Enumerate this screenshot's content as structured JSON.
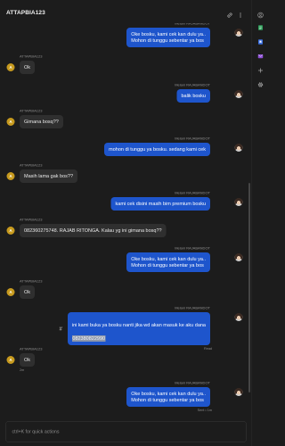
{
  "header": {
    "title": "ATTAPBIA123",
    "icons": [
      "link-icon",
      "more-vertical-icon"
    ]
  },
  "contact": {
    "avatar_letter": "A"
  },
  "messages": [
    {
      "sender": "Melani RAJABANDOT",
      "text": "Oke bosku, kami cek kan dulu ya..\nMohon di tunggu sebentar ya bos"
    },
    {
      "sender": "ATTAPBIA123",
      "text": "Ok"
    },
    {
      "sender": "Melani RAJABANDOT",
      "text": "balik bosku"
    },
    {
      "sender": "ATTAPBIA123",
      "text": "Gimana bosq??"
    },
    {
      "sender": "Melani RAJABANDOT",
      "text": "mohon di tunggu ya bosku. sedang kami cek"
    },
    {
      "sender": "ATTAPBIA123",
      "text": "Masih lama gak bos??"
    },
    {
      "sender": "Melani RAJABANDOT",
      "text": "kami cek disini masih bim premium bosku"
    },
    {
      "sender": "ATTAPBIA123",
      "text": "082360275748. RAJAB RITONGA. Kalau yg ini gimana bosq??"
    },
    {
      "sender": "Melani RAJABANDOT",
      "text": "Oke bosku, kami cek kan dulu ya..\nMohon di tunggu sebentar ya bos"
    },
    {
      "sender": "ATTAPBIA123",
      "text": "Ok"
    },
    {
      "sender": "Melani RAJABANDOT",
      "marker": "#",
      "text": "ini kami buka ya bosku nanti jika wd akan masuk ke aku dana",
      "highlight": "082380822990",
      "meta": "Read"
    },
    {
      "sender": "ATTAPBIA123",
      "text": "Ok",
      "meta": "2m"
    },
    {
      "sender": "Melani RAJABANDOT",
      "text": "Oke bosku, kami cek kan dulu ya..\nMohon di tunggu sebentar ya bos",
      "meta": "Sent • 1m"
    }
  ],
  "composer": {
    "placeholder": "ctrl+K for quick actions"
  },
  "sidebar": {
    "icons": [
      "user-circle-icon",
      "green-app-icon",
      "blue-document-icon",
      "purple-mail-icon",
      "plus-icon",
      "settings-gear-icon"
    ]
  },
  "colors": {
    "background": "#1c1c1c",
    "outgoing_bubble": "#1e55cc",
    "incoming_bubble": "#2f2f2f",
    "contact_avatar": "#c79a1e",
    "selection_highlight": "#8f98aa"
  }
}
